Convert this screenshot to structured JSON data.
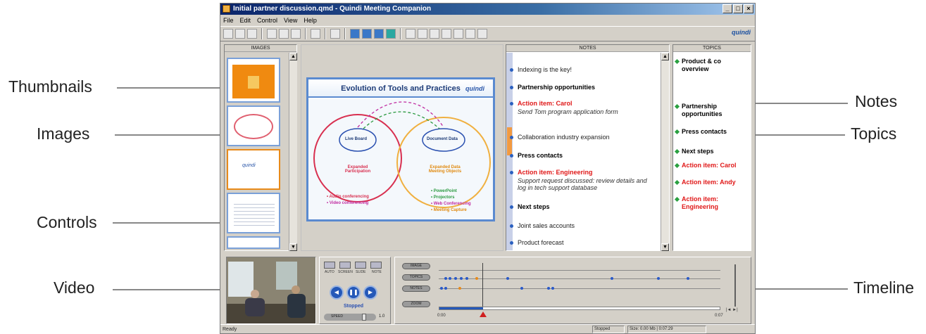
{
  "callouts": {
    "thumbnails": "Thumbnails",
    "images": "Images",
    "controls": "Controls",
    "video": "Video",
    "notes": "Notes",
    "topics": "Topics",
    "timeline": "Timeline"
  },
  "window": {
    "title": "Initial partner discussion.qmd - Quindi Meeting Companion",
    "minimize": "_",
    "maximize": "□",
    "close": "×"
  },
  "menu": [
    "File",
    "Edit",
    "Control",
    "View",
    "Help"
  ],
  "brand": "quindi",
  "panels": {
    "images_header": "IMAGES",
    "notes_header": "NOTES",
    "topics_header": "TOPICS"
  },
  "slide": {
    "title": "Evolution of Tools and Practices",
    "logo": "quindi",
    "live_board": "Live Board",
    "document_data": "Document Data",
    "expanded_participation": "Expanded Participation",
    "expanded_data": "Expanded Data Meeting Objects",
    "left_bullets": [
      "• Audio conferencing",
      "• Video conferencing"
    ],
    "right_bullets": [
      "• PowerPoint",
      "• Projectors",
      "• Web Conferencing",
      "• Meeting Capture"
    ]
  },
  "notes": [
    {
      "text": "Indexing is the key!",
      "style": "n"
    },
    {
      "text": "Partnership opportunities",
      "style": "b"
    },
    {
      "text": "Action item: Carol",
      "style": "r"
    },
    {
      "text": "Send Tom program application form",
      "style": "i"
    },
    {
      "text": "Collaboration industry expansion",
      "style": "n"
    },
    {
      "text": "Press contacts",
      "style": "b"
    },
    {
      "text": "Action item: Engineering",
      "style": "r"
    },
    {
      "text": "Support request discussed: review details and log in tech support database",
      "style": "i"
    },
    {
      "text": "Next steps",
      "style": "b"
    },
    {
      "text": "Joint sales accounts",
      "style": "n"
    },
    {
      "text": "Product forecast",
      "style": "n"
    }
  ],
  "topics": [
    {
      "text": "Product & co overview",
      "style": "b"
    },
    {
      "text": "Partnership opportunities",
      "style": "b"
    },
    {
      "text": "Press contacts",
      "style": "b"
    },
    {
      "text": "Next steps",
      "style": "b"
    },
    {
      "text": "Action item: Carol",
      "style": "r"
    },
    {
      "text": "Action item: Andy",
      "style": "r"
    },
    {
      "text": "Action item: Engineering",
      "style": "r"
    }
  ],
  "controls": {
    "labels": [
      "AUTO",
      "SCREEN",
      "SLIDE",
      "NOTE"
    ],
    "prev": "◀",
    "pause": "❚❚",
    "play": "▶",
    "status": "Stopped",
    "speed_label": "SPEED",
    "speed_value": "1.0"
  },
  "timeline": {
    "buttons": [
      "IMAGE",
      "TOPICS",
      "NOTES",
      "ZOOM"
    ],
    "start": "0:00",
    "end": "0:07",
    "nav": "|◄ ►|"
  },
  "status": {
    "left": "Ready",
    "state": "Stopped",
    "size": "Size: 0.00 Mb  |  0:07:29"
  },
  "colors": {
    "accent": "#2a5ac8",
    "action_red": "#e01818",
    "highlight_orange": "#e88a1a",
    "title_blue": "#0a246a"
  }
}
